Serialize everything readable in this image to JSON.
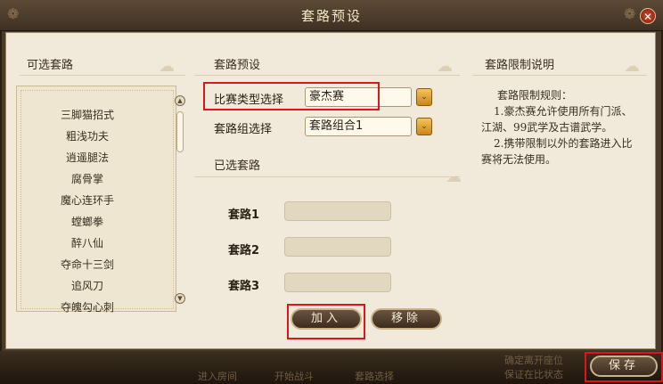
{
  "window": {
    "title": "套路预设",
    "close_glyph": "✕"
  },
  "left": {
    "title": "可选套路",
    "items": [
      "三脚猫招式",
      "粗浅功夫",
      "逍遥腿法",
      "腐骨掌",
      "魔心连环手",
      "螳螂拳",
      "醉八仙",
      "夺命十三剑",
      "追风刀",
      "夺魄勾心刺"
    ],
    "scroll_up": "▲",
    "scroll_down": "▼"
  },
  "middle": {
    "title": "套路预设",
    "match_type_label": "比赛类型选择",
    "match_type_value": "豪杰赛",
    "group_label": "套路组选择",
    "group_value": "套路组合1",
    "selected_title": "已选套路",
    "slots": [
      "套路1",
      "套路2",
      "套路3"
    ],
    "add_button": "加入",
    "remove_button": "移除",
    "arrow_glyph": "⌄"
  },
  "right": {
    "title": "套路限制说明",
    "rule_heading": "套路限制规则：",
    "rule_1": "1.豪杰赛允许使用所有门派、江湖、99武学及古谱武学。",
    "rule_2": "2.携带限制以外的套路进入比赛将无法使用。"
  },
  "bottom": {
    "save_button": "保存",
    "ghost_1": "进入房间",
    "ghost_2": "开始战斗",
    "ghost_3": "套路选择",
    "ghost_4": "确定离开座位",
    "ghost_5": "保证在比状态"
  }
}
